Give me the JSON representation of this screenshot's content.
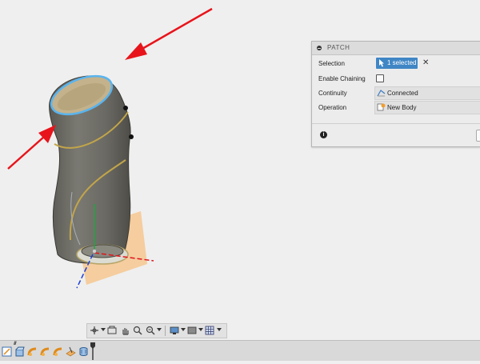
{
  "patch_panel": {
    "title": "PATCH",
    "rows": [
      {
        "label": "Selection",
        "value": "1 selected"
      },
      {
        "label": "Enable Chaining",
        "checked": false
      },
      {
        "label": "Continuity",
        "value": "Connected"
      },
      {
        "label": "Operation",
        "value": "New Body"
      }
    ],
    "selection_clear": "✕",
    "info_icon_text": "i"
  },
  "viewport": {
    "model": "curved pipe solid body",
    "arrow_color": "#e8141b",
    "selected_edge_color": "#5ab4ee",
    "body_color": "#6c6b64"
  },
  "navigation_toolbar": {
    "icons": [
      "orbit-icon",
      "look-at-icon",
      "pan-icon",
      "zoom-icon",
      "fit-icon",
      "display-settings-icon",
      "visual-style-icon",
      "grid-icon"
    ]
  },
  "timeline": {
    "items": [
      "sketch-icon",
      "extrude-icon",
      "sweep-icon",
      "sweep-icon",
      "sweep-icon",
      "plane-icon",
      "patch-icon"
    ]
  }
}
